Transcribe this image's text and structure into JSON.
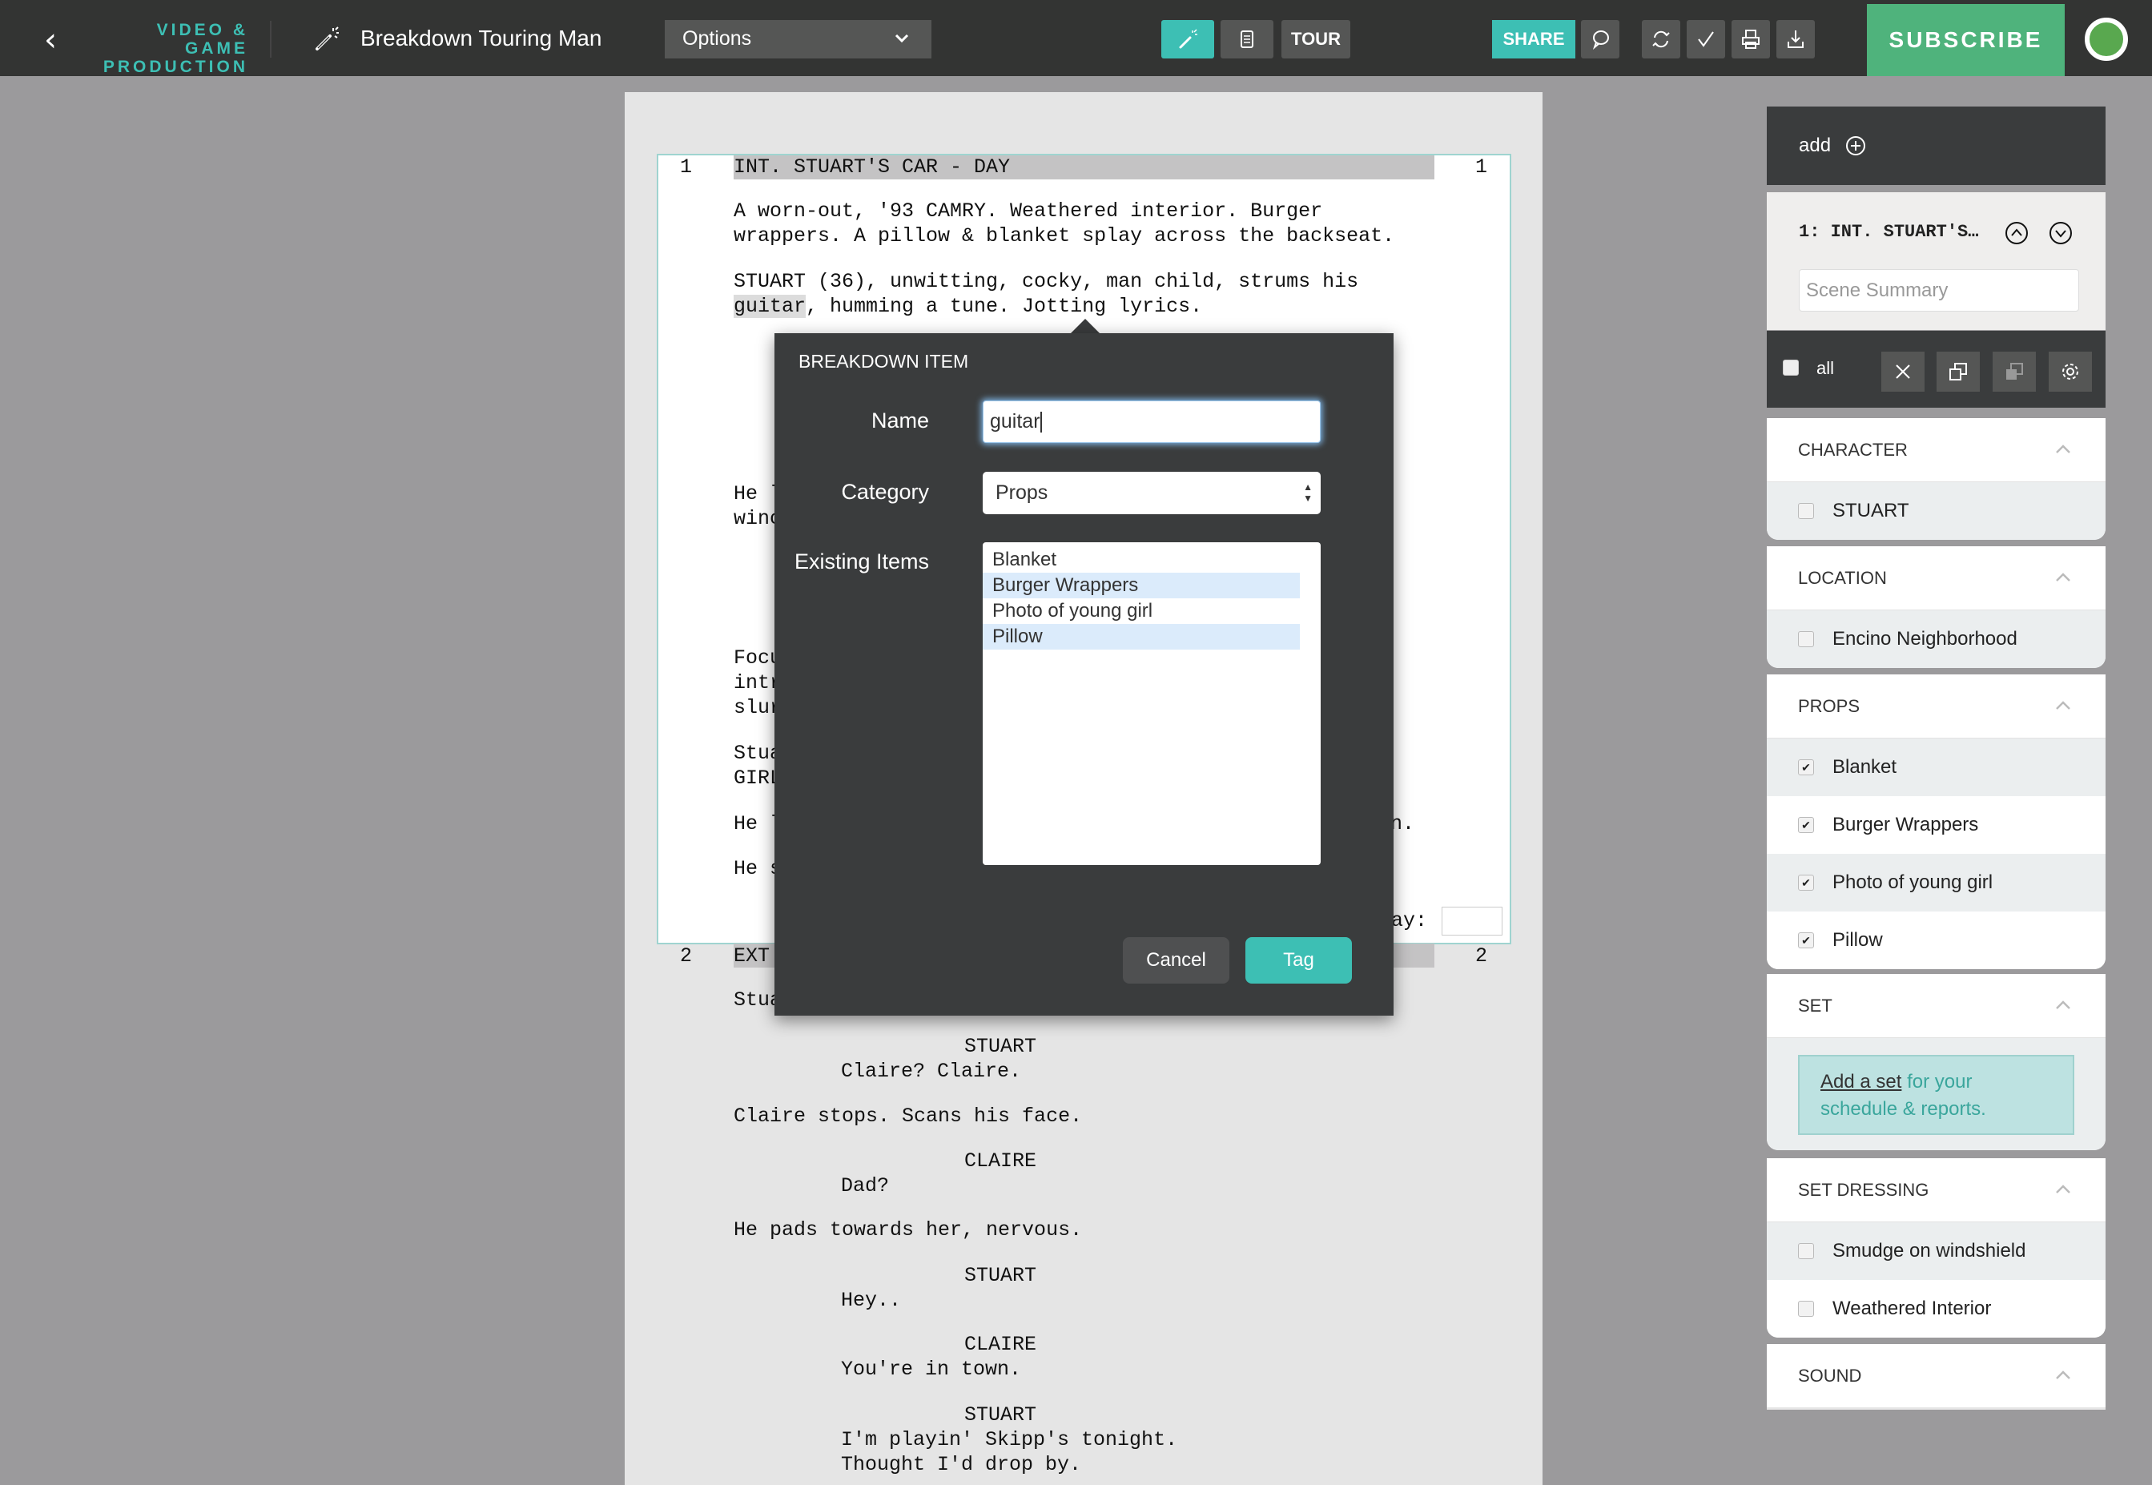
{
  "header": {
    "brand_line1": "VIDEO & GAME",
    "brand_line2": "PRODUCTION",
    "title": "Breakdown Touring Man",
    "options_label": "Options",
    "tour_label": "TOUR",
    "share_label": "SHARE",
    "subscribe_label": "SUBSCRIBE",
    "accent_teal": "#3dbfb4",
    "subscribe_green": "#4fb37c"
  },
  "script": {
    "scene1": {
      "number": "1",
      "heading": "INT. STUART'S CAR - DAY",
      "action1_line1": "A worn-out, '93 CAMRY. Weathered interior. Burger",
      "action1_line2": "wrappers. A pillow & blanket splay across the backseat.",
      "action2_line1": "STUART (36), unwitting, cocky, man child, strums his",
      "action2_highlight": "guitar",
      "action2_line2_rest": ", humming a tune. Jotting lyrics.",
      "partial_lines": [
        "He l",
        "winc",
        "Focu",
        "intr",
        "slur",
        "Stua",
        "GIRL",
        "He l",
        "He s"
      ],
      "right_fragment_1": "n.",
      "day_label": "Day:"
    },
    "scene2": {
      "number": "2",
      "heading_partial": "EXT",
      "action_partial": "Stua",
      "lines": [
        {
          "type": "character",
          "text": "STUART"
        },
        {
          "type": "dialogue",
          "text": "Claire? Claire."
        },
        {
          "type": "action",
          "text": "Claire stops. Scans his face."
        },
        {
          "type": "character",
          "text": "CLAIRE"
        },
        {
          "type": "dialogue",
          "text": "Dad?"
        },
        {
          "type": "action",
          "text": "He pads towards her, nervous."
        },
        {
          "type": "character",
          "text": "STUART"
        },
        {
          "type": "dialogue",
          "text": "Hey.."
        },
        {
          "type": "character",
          "text": "CLAIRE"
        },
        {
          "type": "dialogue",
          "text": "You're in town."
        },
        {
          "type": "character",
          "text": "STUART"
        },
        {
          "type": "dialogue",
          "text": "I'm playin' Skipp's tonight."
        },
        {
          "type": "dialogue",
          "text": "Thought I'd drop by."
        }
      ]
    }
  },
  "dialog": {
    "title": "BREAKDOWN ITEM",
    "name_label": "Name",
    "name_value": "guitar",
    "category_label": "Category",
    "category_value": "Props",
    "existing_label": "Existing Items",
    "existing_items": [
      {
        "label": "Blanket",
        "selected": false
      },
      {
        "label": "Burger Wrappers",
        "selected": true
      },
      {
        "label": "Photo of young girl",
        "selected": false
      },
      {
        "label": "Pillow",
        "selected": true
      }
    ],
    "cancel_label": "Cancel",
    "tag_label": "Tag"
  },
  "sidebar": {
    "add_label": "add",
    "scene_name": "1: INT. STUART'S…",
    "scene_summary_placeholder": "Scene Summary",
    "select_all_label": "all",
    "categories": [
      {
        "title": "CHARACTER",
        "items": [
          {
            "label": "STUART",
            "checked": false
          }
        ]
      },
      {
        "title": "LOCATION",
        "items": [
          {
            "label": "Encino Neighborhood",
            "checked": false
          }
        ]
      },
      {
        "title": "PROPS",
        "items": [
          {
            "label": "Blanket",
            "checked": true
          },
          {
            "label": "Burger Wrappers",
            "checked": true
          },
          {
            "label": "Photo of young girl",
            "checked": true
          },
          {
            "label": "Pillow",
            "checked": true
          }
        ]
      },
      {
        "title": "SET",
        "note_link": "Add a set",
        "note_text": " for your schedule & reports."
      },
      {
        "title": "SET DRESSING",
        "items": [
          {
            "label": "Smudge on windshield",
            "checked": false
          },
          {
            "label": "Weathered Interior",
            "checked": false
          }
        ]
      },
      {
        "title": "SOUND",
        "items": []
      }
    ]
  }
}
